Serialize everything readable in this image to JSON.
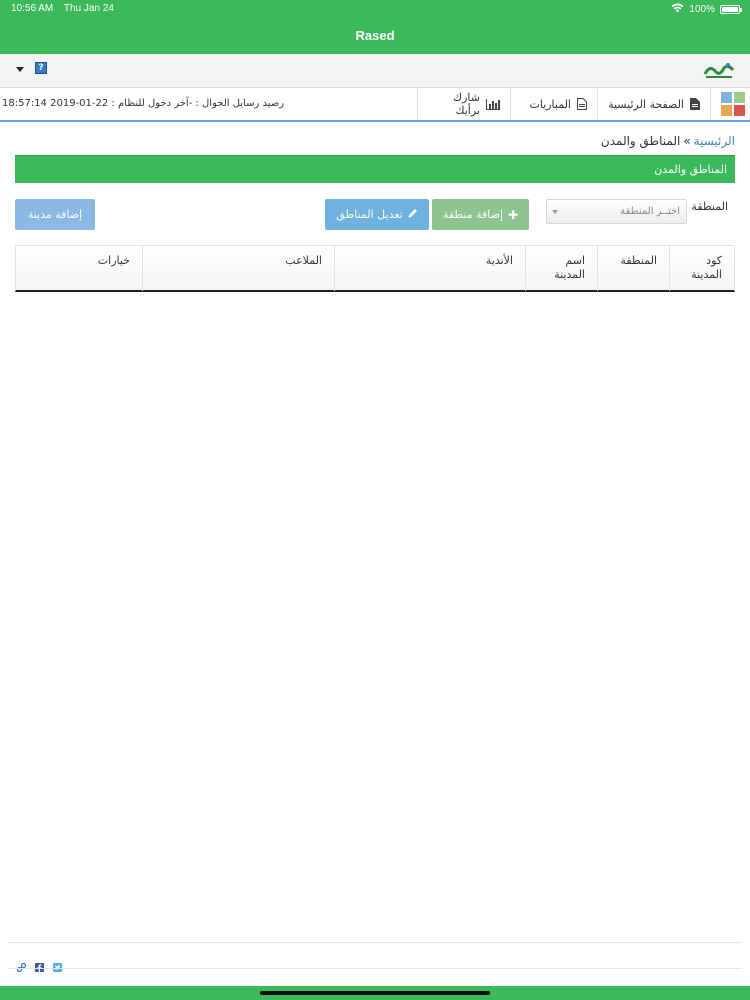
{
  "status_bar": {
    "time": "10:56 AM",
    "date": "Thu Jan 24",
    "battery": "100%",
    "battery_level": 1.0
  },
  "app": {
    "title": "Rased"
  },
  "logo_bar": {
    "help_label": "?"
  },
  "nav": {
    "items": [
      {
        "label": "الصفحة الرئيسية",
        "icon": "document-icon"
      },
      {
        "label": "المباريات",
        "icon": "document-outline-icon"
      },
      {
        "label": "شارك برأيك",
        "icon": "bar-chart-icon"
      }
    ],
    "meta": "رصيد رسايل الجوال : -آخر دخول للنظام : 22-01-2019 18:57:14"
  },
  "breadcrumb": {
    "home": "الرئيسية",
    "separator": "»",
    "current": "المناطق والمدن"
  },
  "section": {
    "title": "المناطق والمدن"
  },
  "filters": {
    "region_label": "المنطقة",
    "region_placeholder": "اختــر المنطقة"
  },
  "buttons": {
    "add_region": "إضافة منطقة",
    "edit_regions": "تعديل المناطق",
    "add_city": "إضافة مدينة"
  },
  "table": {
    "headers": [
      "كود المدينة",
      "المنطقة",
      "اسم المدينة",
      "الأندية",
      "الملاعب",
      "خيارات"
    ]
  },
  "colors": {
    "brand_green": "#3cb95a",
    "link_blue": "#3f7fbf",
    "nav_underline": "#6ca0dc"
  }
}
